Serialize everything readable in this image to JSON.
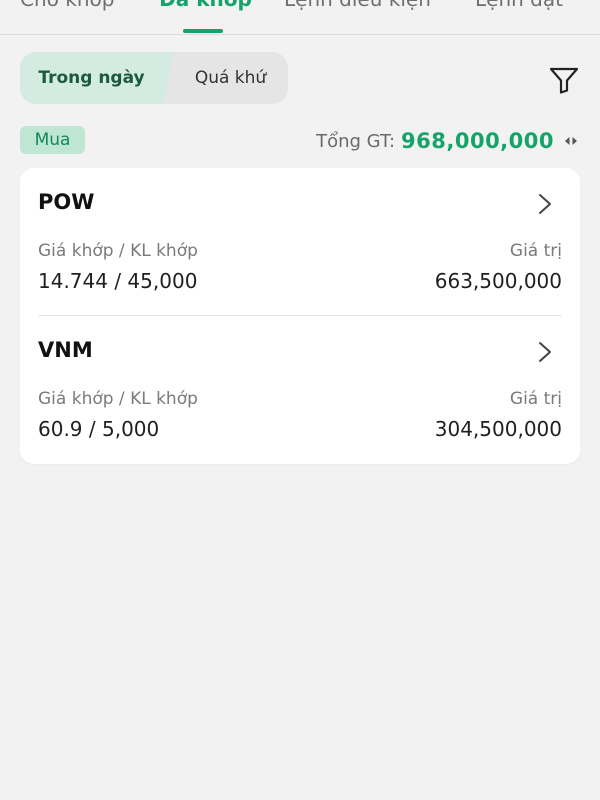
{
  "tabs": [
    {
      "label": "Chờ khớp",
      "active": false
    },
    {
      "label": "Đã khớp",
      "active": true
    },
    {
      "label": "Lệnh điều kiện",
      "active": false
    },
    {
      "label": "Lệnh đặt",
      "active": false
    }
  ],
  "segment": {
    "today_label": "Trong ngày",
    "past_label": "Quá khứ",
    "selected": "Trong ngày"
  },
  "filter_icon": "filter-icon",
  "side_tag": "Mua",
  "total": {
    "label": "Tổng GT:",
    "value": "968,000,000",
    "toggle_icon": "left-right-arrows-icon"
  },
  "orders": [
    {
      "symbol": "POW",
      "price_qty_label": "Giá khớp / KL khớp",
      "price_qty_value": "14.744 / 45,000",
      "value_label": "Giá trị",
      "value": "663,500,000"
    },
    {
      "symbol": "VNM",
      "price_qty_label": "Giá khớp / KL khớp",
      "price_qty_value": "60.9 / 5,000",
      "value_label": "Giá trị",
      "value": "304,500,000"
    }
  ],
  "colors": {
    "accent": "#16a36a",
    "background": "#f2f2f2",
    "card": "#ffffff",
    "segment_selected": "#d3ebe0",
    "buy_tag_bg": "#bfe6d2"
  }
}
